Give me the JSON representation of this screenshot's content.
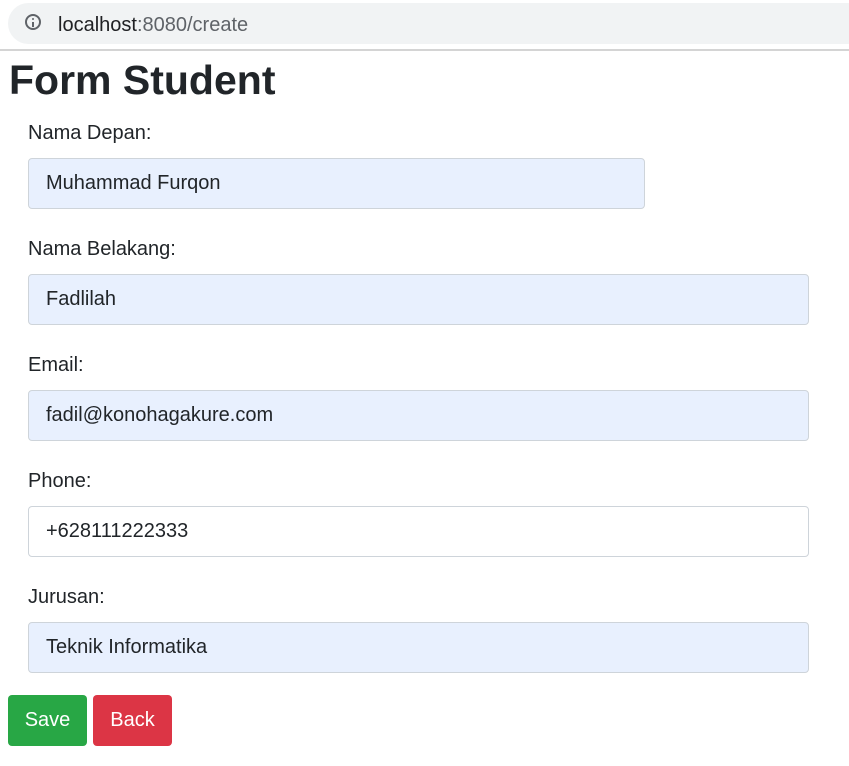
{
  "browser": {
    "url_host": "localhost",
    "url_path": ":8080/create"
  },
  "page": {
    "title": "Form Student"
  },
  "form": {
    "first_name": {
      "label": "Nama Depan:",
      "value": "Muhammad Furqon"
    },
    "last_name": {
      "label": "Nama Belakang:",
      "value": "Fadlilah"
    },
    "email": {
      "label": "Email:",
      "value": "fadil@konohagakure.com"
    },
    "phone": {
      "label": "Phone:",
      "value": "+628111222333"
    },
    "major": {
      "label": "Jurusan:",
      "value": "Teknik Informatika"
    }
  },
  "actions": {
    "save_label": "Save",
    "back_label": "Back"
  },
  "colors": {
    "autofill_bg": "#e8f0fe",
    "save_button": "#28a745",
    "back_button": "#dc3545",
    "text": "#212529"
  }
}
